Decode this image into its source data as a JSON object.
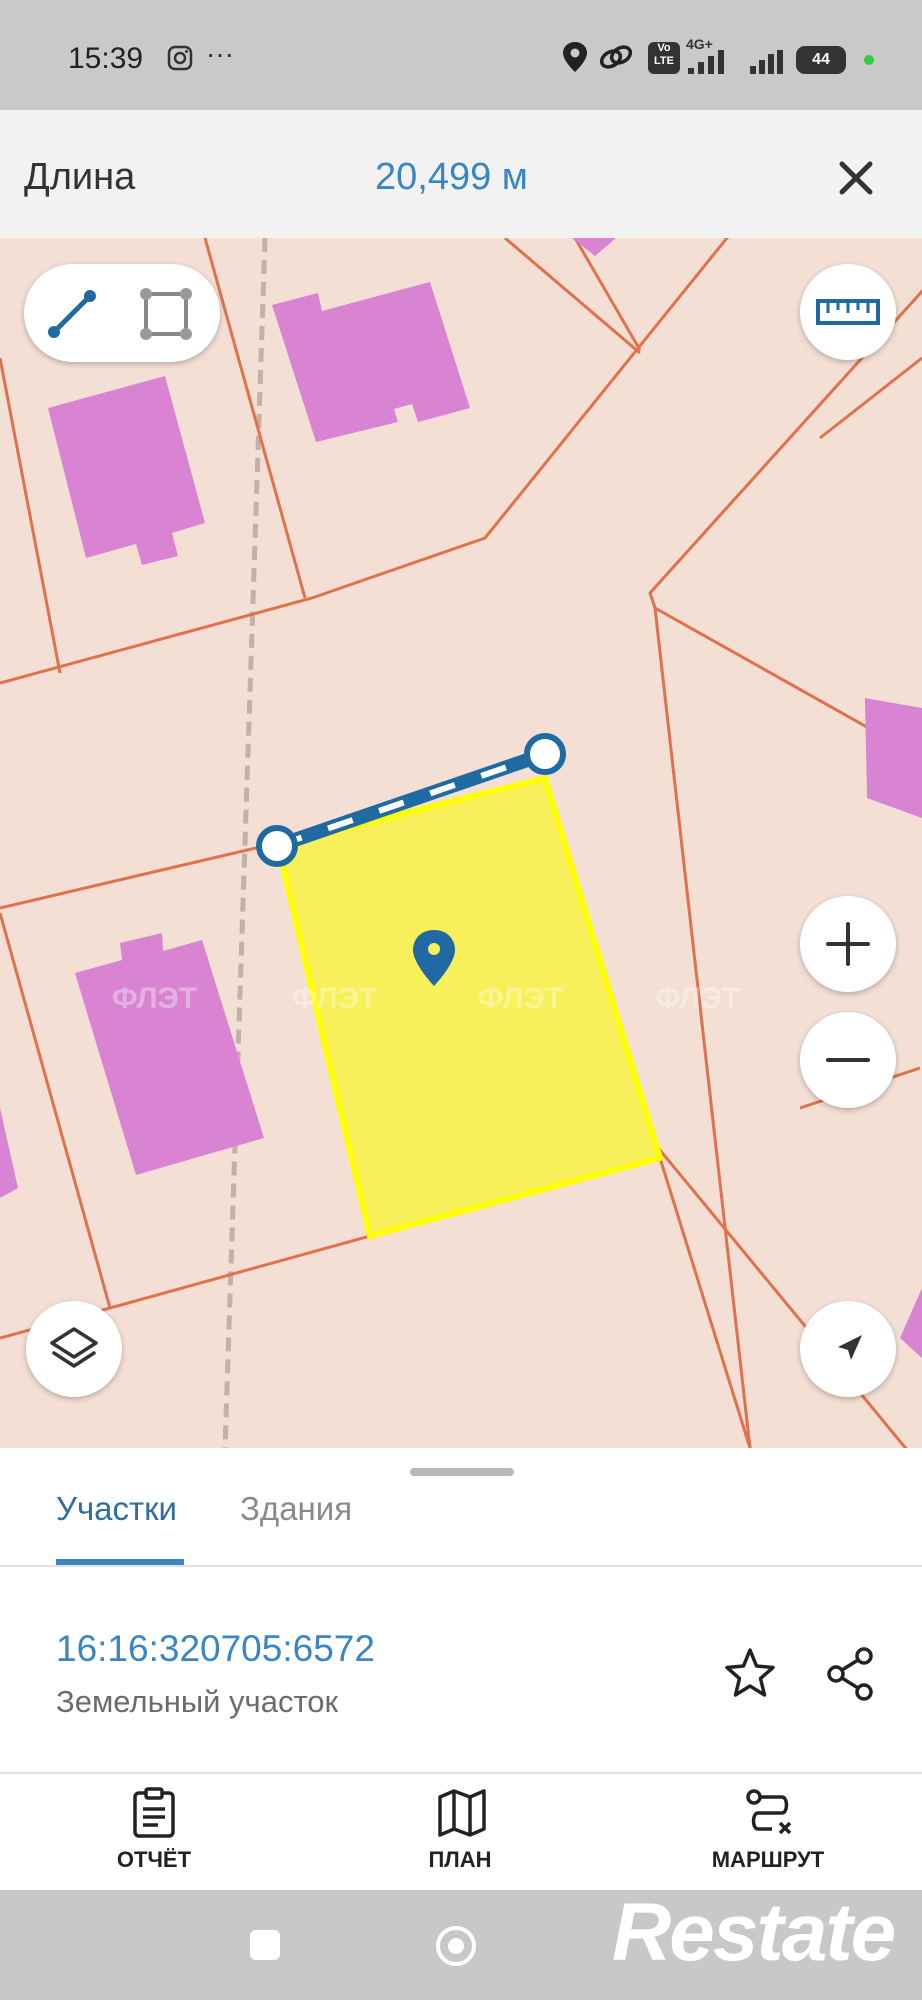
{
  "status_bar": {
    "time": "15:39",
    "more": "···",
    "network_4g": "4G+",
    "volte": "Vo LTE",
    "battery": "44"
  },
  "measure_bar": {
    "label": "Длина",
    "value": "20,499 м"
  },
  "map": {
    "watermarks": [
      "ФЛЭТ",
      "ФЛЭТ",
      "ФЛЭТ",
      "ФЛЭТ"
    ],
    "colors": {
      "background": "#f3dfd4",
      "parcel_lines": "#e0714d",
      "buildings": "#d884d2",
      "selected_parcel": "#f8f05a",
      "measure_line": "#1f6aa3"
    }
  },
  "tabs": [
    {
      "label": "Участки",
      "active": true
    },
    {
      "label": "Здания",
      "active": false
    }
  ],
  "parcel": {
    "cadastral_number": "16:16:320705:6572",
    "type": "Земельный участок"
  },
  "actions": [
    {
      "label": "ОТЧЁТ",
      "icon": "report-icon"
    },
    {
      "label": "ПЛАН",
      "icon": "map-icon"
    },
    {
      "label": "МАРШРУТ",
      "icon": "route-icon"
    }
  ],
  "watermark": "Restate"
}
